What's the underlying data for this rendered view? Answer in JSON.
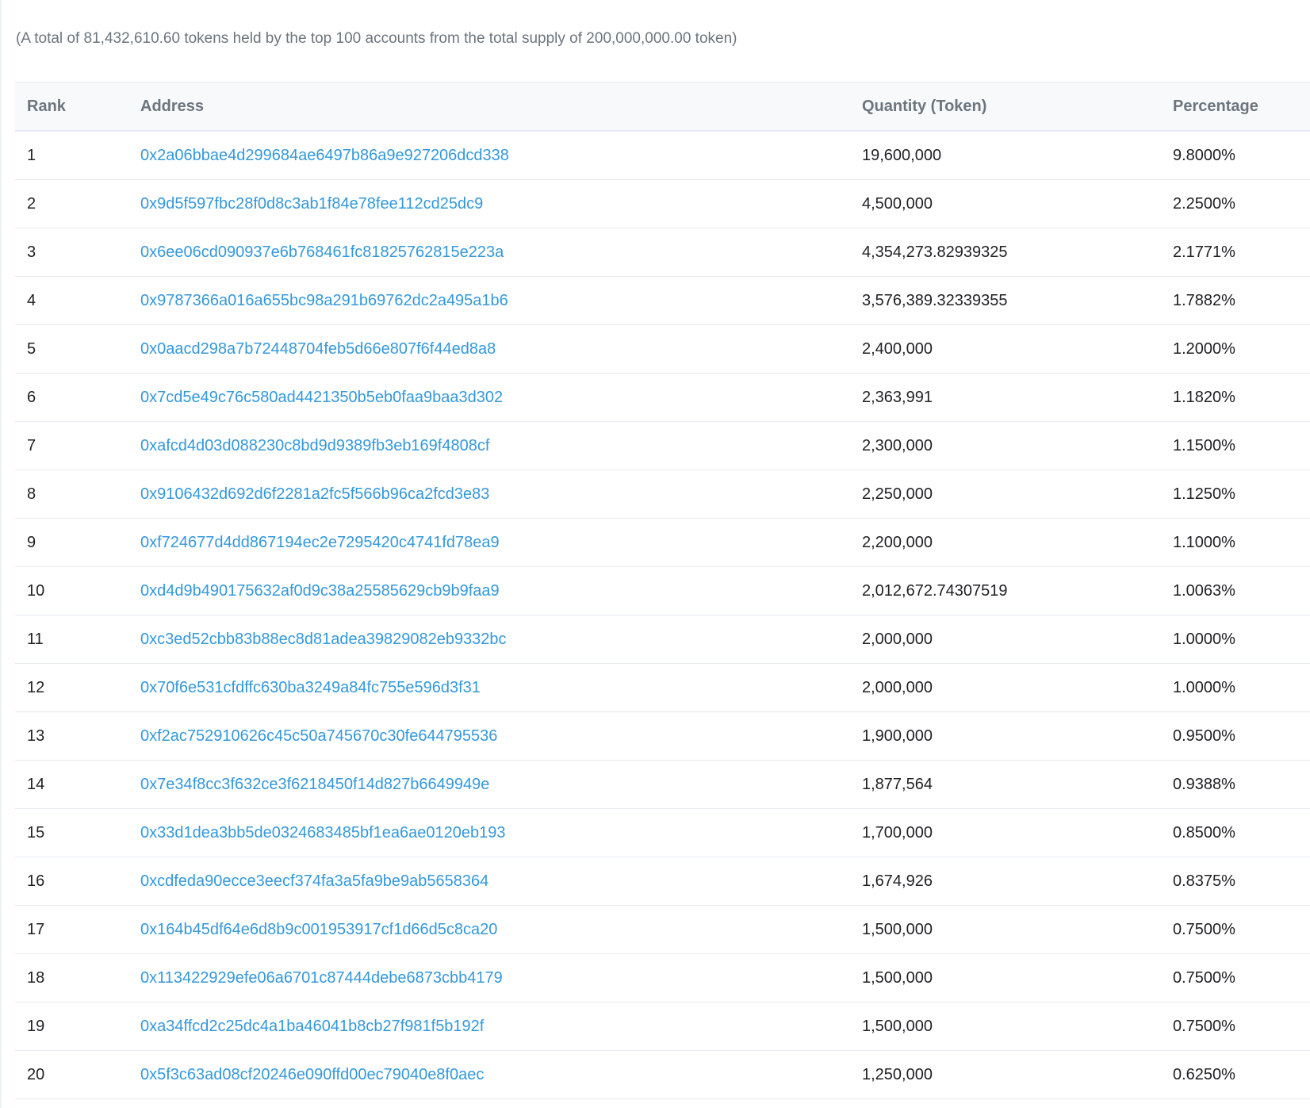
{
  "summary": "(A total of 81,432,610.60 tokens held by the top 100 accounts from the total supply of 200,000,000.00 token)",
  "colors": {
    "link": "#3498db",
    "header_text": "#6c757d",
    "border": "#e7eaf3"
  },
  "table": {
    "headers": {
      "rank": "Rank",
      "address": "Address",
      "quantity": "Quantity (Token)",
      "percentage": "Percentage"
    },
    "rows": [
      {
        "rank": "1",
        "address": "0x2a06bbae4d299684ae6497b86a9e927206dcd338",
        "quantity": "19,600,000",
        "percentage": "9.8000%"
      },
      {
        "rank": "2",
        "address": "0x9d5f597fbc28f0d8c3ab1f84e78fee112cd25dc9",
        "quantity": "4,500,000",
        "percentage": "2.2500%"
      },
      {
        "rank": "3",
        "address": "0x6ee06cd090937e6b768461fc81825762815e223a",
        "quantity": "4,354,273.82939325",
        "percentage": "2.1771%"
      },
      {
        "rank": "4",
        "address": "0x9787366a016a655bc98a291b69762dc2a495a1b6",
        "quantity": "3,576,389.32339355",
        "percentage": "1.7882%"
      },
      {
        "rank": "5",
        "address": "0x0aacd298a7b72448704feb5d66e807f6f44ed8a8",
        "quantity": "2,400,000",
        "percentage": "1.2000%"
      },
      {
        "rank": "6",
        "address": "0x7cd5e49c76c580ad4421350b5eb0faa9baa3d302",
        "quantity": "2,363,991",
        "percentage": "1.1820%"
      },
      {
        "rank": "7",
        "address": "0xafcd4d03d088230c8bd9d9389fb3eb169f4808cf",
        "quantity": "2,300,000",
        "percentage": "1.1500%"
      },
      {
        "rank": "8",
        "address": "0x9106432d692d6f2281a2fc5f566b96ca2fcd3e83",
        "quantity": "2,250,000",
        "percentage": "1.1250%"
      },
      {
        "rank": "9",
        "address": "0xf724677d4dd867194ec2e7295420c4741fd78ea9",
        "quantity": "2,200,000",
        "percentage": "1.1000%"
      },
      {
        "rank": "10",
        "address": "0xd4d9b490175632af0d9c38a25585629cb9b9faa9",
        "quantity": "2,012,672.74307519",
        "percentage": "1.0063%"
      },
      {
        "rank": "11",
        "address": "0xc3ed52cbb83b88ec8d81adea39829082eb9332bc",
        "quantity": "2,000,000",
        "percentage": "1.0000%"
      },
      {
        "rank": "12",
        "address": "0x70f6e531cfdffc630ba3249a84fc755e596d3f31",
        "quantity": "2,000,000",
        "percentage": "1.0000%"
      },
      {
        "rank": "13",
        "address": "0xf2ac752910626c45c50a745670c30fe644795536",
        "quantity": "1,900,000",
        "percentage": "0.9500%"
      },
      {
        "rank": "14",
        "address": "0x7e34f8cc3f632ce3f6218450f14d827b6649949e",
        "quantity": "1,877,564",
        "percentage": "0.9388%"
      },
      {
        "rank": "15",
        "address": "0x33d1dea3bb5de0324683485bf1ea6ae0120eb193",
        "quantity": "1,700,000",
        "percentage": "0.8500%"
      },
      {
        "rank": "16",
        "address": "0xcdfeda90ecce3eecf374fa3a5fa9be9ab5658364",
        "quantity": "1,674,926",
        "percentage": "0.8375%"
      },
      {
        "rank": "17",
        "address": "0x164b45df64e6d8b9c001953917cf1d66d5c8ca20",
        "quantity": "1,500,000",
        "percentage": "0.7500%"
      },
      {
        "rank": "18",
        "address": "0x113422929efe06a6701c87444debe6873cbb4179",
        "quantity": "1,500,000",
        "percentage": "0.7500%"
      },
      {
        "rank": "19",
        "address": "0xa34ffcd2c25dc4a1ba46041b8cb27f981f5b192f",
        "quantity": "1,500,000",
        "percentage": "0.7500%"
      },
      {
        "rank": "20",
        "address": "0x5f3c63ad08cf20246e090ffd00ec79040e8f0aec",
        "quantity": "1,250,000",
        "percentage": "0.6250%"
      }
    ]
  }
}
